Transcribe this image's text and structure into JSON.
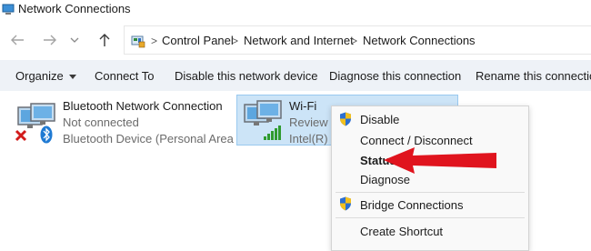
{
  "window": {
    "title": "Network Connections"
  },
  "address_bar": {
    "crumbs": [
      "Control Panel",
      "Network and Internet",
      "Network Connections"
    ]
  },
  "toolbar": {
    "organize": "Organize",
    "connect_to": "Connect To",
    "disable_device": "Disable this network device",
    "diagnose": "Diagnose this connection",
    "rename": "Rename this connection"
  },
  "connections": [
    {
      "name": "Bluetooth Network Connection",
      "status": "Not connected",
      "device": "Bluetooth Device (Personal Area ..."
    },
    {
      "name": "Wi-Fi",
      "status": "Review G",
      "device": "Intel(R) W"
    }
  ],
  "context_menu": {
    "disable": "Disable",
    "connect_disconnect": "Connect / Disconnect",
    "status": "Status",
    "diagnose": "Diagnose",
    "bridge": "Bridge Connections",
    "create_shortcut": "Create Shortcut"
  },
  "colors": {
    "arrow": "#e0141e",
    "selection": "#cce4f7",
    "commandbar": "#eef2f7"
  },
  "icons": [
    "network-icon",
    "back-arrow-icon",
    "forward-arrow-icon",
    "chevron-down-icon",
    "up-arrow-icon",
    "control-panel-icon",
    "shield-icon",
    "bluetooth-icon",
    "red-x-icon",
    "signal-bars-icon"
  ]
}
